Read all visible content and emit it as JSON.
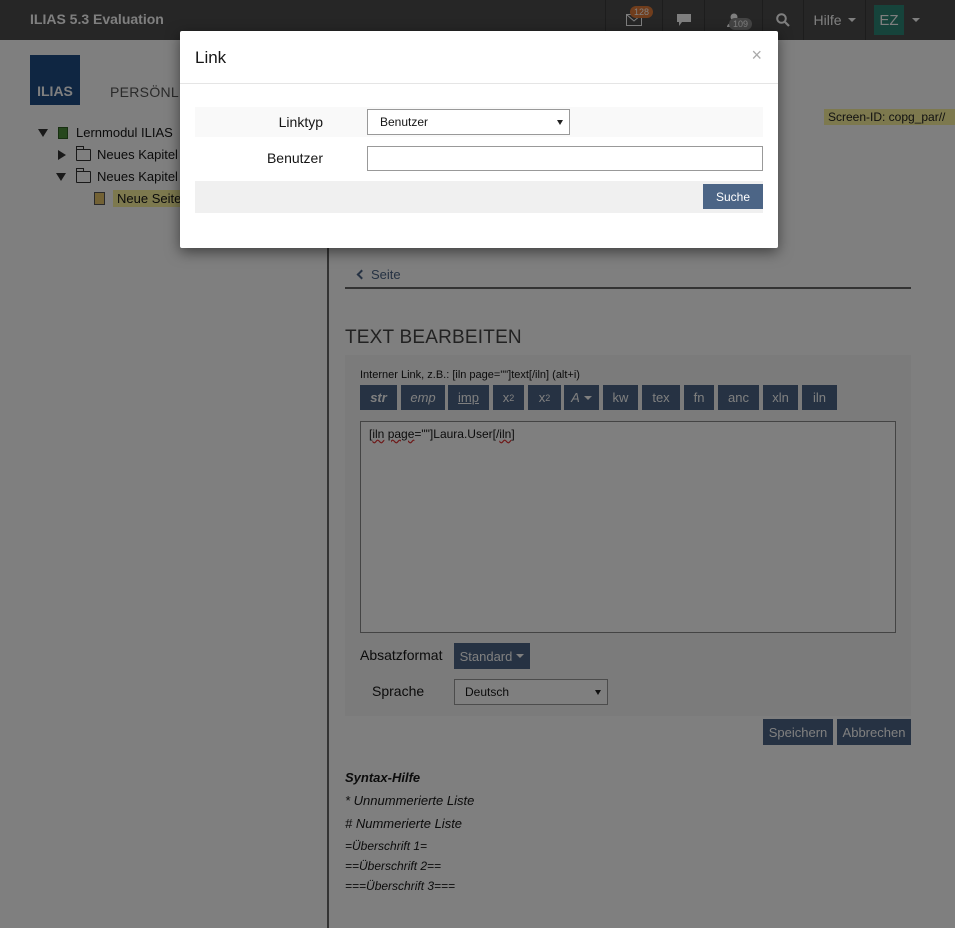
{
  "topbar": {
    "brand": "ILIAS 5.3 Evaluation",
    "mail_badge": "128",
    "users_badge": "109",
    "help_label": "Hilfe",
    "avatar_initials": "EZ"
  },
  "header": {
    "logo_text": "ILIAS",
    "nav_partial": "PERSÖNLIC"
  },
  "tree": {
    "items": [
      {
        "label": "Lernmodul ILIAS",
        "icon": "learning-module-icon"
      },
      {
        "label": "Neues Kapitel",
        "icon": "folder-icon"
      },
      {
        "label": "Neues Kapitel",
        "icon": "folder-icon"
      },
      {
        "label": "Neue Seite",
        "icon": "page-icon"
      }
    ]
  },
  "screen_id": "Screen-ID: copg_par//",
  "main": {
    "back_link": "Seite",
    "section_title": "TEXT BEARBEITEN",
    "hint": "Interner Link, z.B.: [iln page=\"\"]text[/iln] (alt+i)",
    "toolbar": [
      "str",
      "emp",
      "imp",
      "x",
      "x",
      "A",
      "kw",
      "tex",
      "fn",
      "anc",
      "xln",
      "iln"
    ],
    "sup_mark": "2",
    "sub_mark": "2",
    "editor_text_pre": "[",
    "editor_text_iln1": "iln",
    "editor_text_space": " ",
    "editor_text_page": "page",
    "editor_text_mid": "=\"\"]Laura.User[/",
    "editor_text_iln2": "iln",
    "editor_text_end": "]",
    "paragraph_format_label": "Absatzformat",
    "paragraph_format_value": "Standard",
    "language_label": "Sprache",
    "language_value": "Deutsch",
    "save_label": "Speichern",
    "cancel_label": "Abbrechen",
    "syntax_title": "Syntax-Hilfe",
    "syntax_lines": [
      "* Unnummerierte Liste",
      "# Nummerierte Liste",
      "=Überschrift 1=",
      "==Überschrift 2==",
      "===Überschrift 3==="
    ]
  },
  "modal": {
    "title": "Link",
    "close_symbol": "×",
    "linktype_label": "Linktyp",
    "linktype_value": "Benutzer",
    "user_label": "Benutzer",
    "user_value": "",
    "search_label": "Suche"
  },
  "colors": {
    "topbar": "#4c4c4c",
    "primary_button": "#4c6586",
    "highlight": "#fbf39d",
    "avatar": "#2d8677"
  }
}
